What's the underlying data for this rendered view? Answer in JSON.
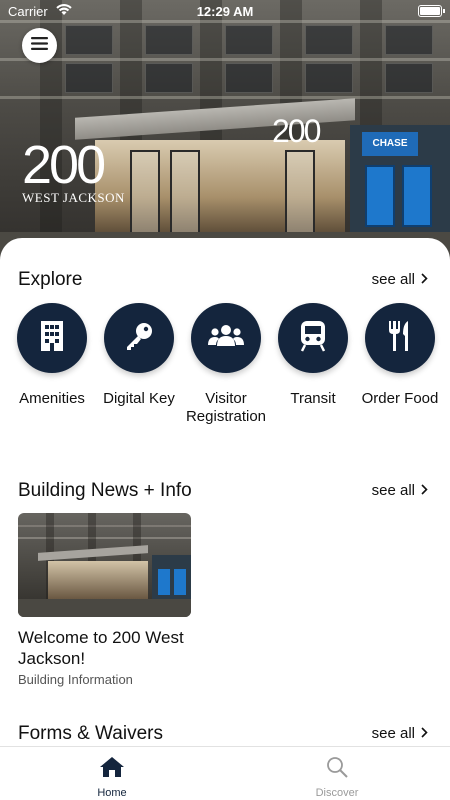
{
  "status_bar": {
    "carrier": "Carrier",
    "time": "12:29 AM"
  },
  "hero": {
    "logo_number": "200",
    "logo_text": "WEST JACKSON",
    "sign_number": "200",
    "bank_sign": "CHASE"
  },
  "explore": {
    "title": "Explore",
    "see_all": "see all",
    "items": [
      {
        "label": "Amenities",
        "icon": "building-icon"
      },
      {
        "label": "Digital Key",
        "icon": "key-icon"
      },
      {
        "label": "Visitor Registration",
        "icon": "users-icon"
      },
      {
        "label": "Transit",
        "icon": "train-icon"
      },
      {
        "label": "Order Food",
        "icon": "utensils-icon"
      }
    ]
  },
  "news": {
    "title": "Building News + Info",
    "see_all": "see all",
    "item": {
      "title": "Welcome to 200 West Jackson!",
      "category": "Building Information"
    }
  },
  "forms": {
    "title": "Forms & Waivers",
    "see_all": "see all"
  },
  "tabbar": {
    "tabs": [
      {
        "label": "Home",
        "active": true
      },
      {
        "label": "Discover",
        "active": false
      }
    ]
  },
  "colors": {
    "accent": "#14253d",
    "inactive": "#9a9a9a"
  }
}
